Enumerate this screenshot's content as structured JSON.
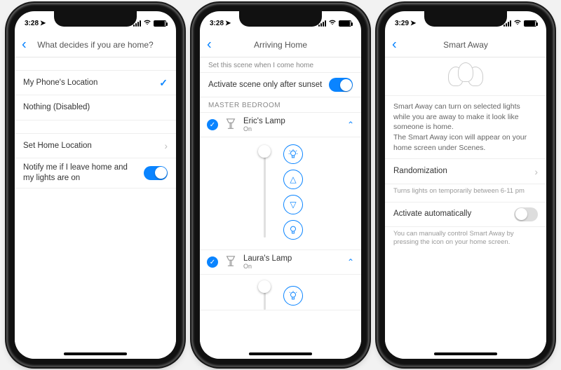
{
  "screen1": {
    "status_time": "3:28",
    "title": "What decides if you are home?",
    "option_phone": "My Phone's Location",
    "option_nothing": "Nothing (Disabled)",
    "set_home": "Set Home Location",
    "notify_label": "Notify me if I leave home and my lights are on"
  },
  "screen2": {
    "status_time": "3:28",
    "title": "Arriving Home",
    "section_set": "Set this scene when I come home",
    "sunset_label": "Activate scene only after sunset",
    "room_header": "MASTER BEDROOM",
    "lamp1_name": "Eric's Lamp",
    "lamp1_state": "On",
    "lamp2_name": "Laura's Lamp",
    "lamp2_state": "On"
  },
  "screen3": {
    "status_time": "3:29",
    "title": "Smart Away",
    "description": "Smart Away can turn on selected lights while you are away to make it look like someone is home.\nThe Smart Away icon will appear on your home screen under Scenes.",
    "randomization_label": "Randomization",
    "randomization_sub": "Turns lights on temporarily between 6-11 pm",
    "activate_label": "Activate automatically",
    "activate_sub": "You can manually control Smart Away by pressing the icon on your home screen."
  }
}
